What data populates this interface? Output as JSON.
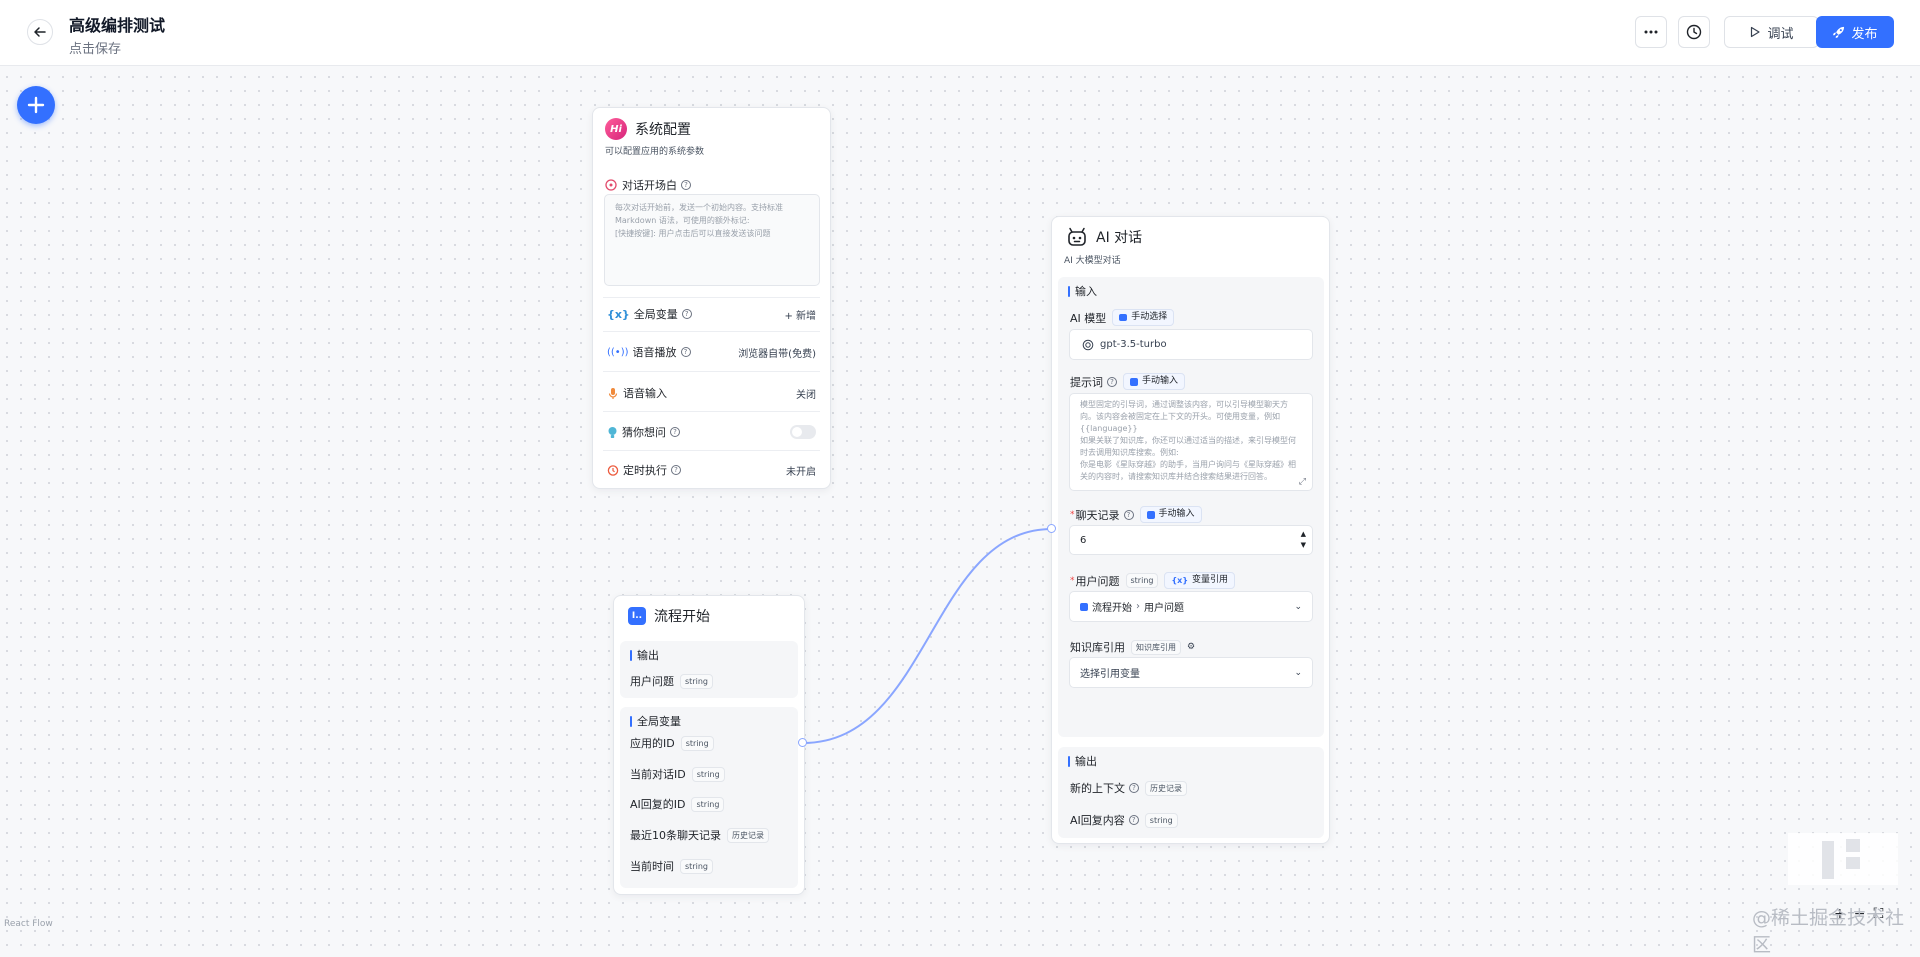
{
  "header": {
    "title": "高级编排测试",
    "subtitle": "点击保存",
    "debug_label": "调试",
    "publish_label": "发布"
  },
  "colors": {
    "accent": "#3370ff",
    "edge": "#8aa6ff"
  },
  "system_node": {
    "title": "系统配置",
    "desc": "可以配置应用的系统参数",
    "welcome": {
      "label": "对话开场白",
      "placeholder": "每次对话开始前，发送一个初始内容。支持标准\nMarkdown 语法，可使用的额外标记:\n[快捷按键]: 用户点击后可以直接发送该问题"
    },
    "rows": {
      "global_var": {
        "label": "全局变量",
        "value": "+ 新增"
      },
      "tts": {
        "label": "语音播放",
        "value": "浏览器自带(免费)"
      },
      "voice_input": {
        "label": "语音输入",
        "value": "关闭"
      },
      "guess": {
        "label": "猜你想问",
        "on": false
      },
      "schedule": {
        "label": "定时执行",
        "value": "未开启"
      }
    }
  },
  "start_node": {
    "title": "流程开始",
    "output_title": "输出",
    "outputs": [
      {
        "name": "用户问题",
        "type": "string"
      }
    ],
    "global_title": "全局变量",
    "globals": [
      {
        "name": "应用的ID",
        "type": "string"
      },
      {
        "name": "当前对话ID",
        "type": "string"
      },
      {
        "name": "AI回复的ID",
        "type": "string"
      },
      {
        "name": "最近10条聊天记录",
        "type": "历史记录"
      },
      {
        "name": "当前时间",
        "type": "string"
      }
    ]
  },
  "ai_node": {
    "title": "AI 对话",
    "desc": "AI 大模型对话",
    "input_title": "输入",
    "model": {
      "label": "AI 模型",
      "chip": "手动选择",
      "value": "gpt-3.5-turbo"
    },
    "prompt": {
      "label": "提示词",
      "chip": "手动输入",
      "placeholder": "模型固定的引导词，通过调整该内容，可以引导模型聊天方向。该内容会被固定在上下文的开头。可使用变量，例如 {{language}}\n如果关联了知识库，你还可以通过适当的描述，来引导模型何时去调用知识库搜索。例如:\n你是电影《星际穿越》的助手，当用户询问与《星际穿越》相关的内容时，请搜索知识库并结合搜索结果进行回答。"
    },
    "history": {
      "label": "聊天记录",
      "chip": "手动输入",
      "value": "6"
    },
    "question": {
      "label": "用户问题",
      "type": "string",
      "chip": "变量引用",
      "path_node": "流程开始",
      "path_field": "用户问题"
    },
    "kb": {
      "label": "知识库引用",
      "type": "知识库引用",
      "placeholder": "选择引用变量"
    },
    "output_title": "输出",
    "outputs": [
      {
        "name": "新的上下文",
        "type": "历史记录"
      },
      {
        "name": "AI回复内容",
        "type": "string"
      }
    ]
  },
  "footer": {
    "react_flow": "React Flow",
    "watermark": "@稀土掘金技术社区"
  }
}
